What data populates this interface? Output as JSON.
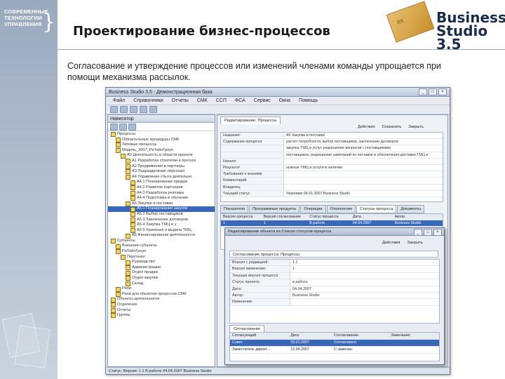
{
  "brand": {
    "company_logo": "СОВРЕМЕННЫЕ ТЕХНОЛОГИИ УПРАВЛЕНИЯ",
    "product_name": "Business Studio 3.5"
  },
  "slide": {
    "title": "Проектирование бизнес-процессов",
    "description": "Согласование и утверждение процессов или изменений членами команды упрощается при помощи механизма рассылок."
  },
  "app": {
    "title": "Business Studio 3.5 - Демонстрационная база",
    "menu": [
      "Файл",
      "Справочники",
      "Отчеты",
      "СМК",
      "ССП",
      "ФСА",
      "Сервис",
      "Окна",
      "Помощь"
    ],
    "navigator": {
      "title": "Навигатор",
      "items": [
        "Процессы",
        "Обязательные процедуры СМК",
        "Типовые процессы",
        "Модель_2007_РиТейлГроуп",
        "А0 Деятельность в области проекти",
        "А1 Разработка стратегии и прогноз",
        "А2 Продвижение в партнеры",
        "А3 Подразделение персонал",
        "А4 Управление сбыта деятельно",
        "А4.1 Планирование продаж",
        "А4.2 Развитие партнеров",
        "А4.3 Разработка рекламы",
        "А4.4 Подготовка и обучение",
        "А5 Закупки и поставки",
        "А5.1 Планирование закупок",
        "А5.2 Выбор поставщиков",
        "А5.3 Заключение договоров",
        "А5.4 Закупка ТМЦ и у",
        "А5.5 Хранение и выдача ТМЦ",
        "А6 Финансирование деятельности",
        "Субъекты",
        "Внешние субъекты",
        "РиТейлГроуп",
        "Персонал",
        "Руководство",
        "Администрация",
        "Отдел продаж",
        "Отдел закупок",
        "Склад",
        "Роли",
        "Роли для объектов процессов СМК",
        "Объекты деятельности",
        "Отделение",
        "Отчеты",
        "Группы"
      ],
      "selected_index": 14
    },
    "pane": {
      "tab_label": "Редактирование: Процессы",
      "actions": [
        "Действия",
        "Сохранить",
        "Закрыть"
      ],
      "fields": [
        [
          "Название:",
          "А5 Закупки и поставки"
        ],
        [
          "Содержание процесса",
          "расчет потребности, выбор поставщиков, заключение договоров"
        ],
        [
          "",
          "закупка ТМЦ и услуг, разрешение вопросов с поставщиками"
        ],
        [
          "",
          "поставщиков, разрешение замечаний по поставке и обеспечения доставки ТМЦ и"
        ],
        [
          "Начало",
          ""
        ],
        [
          "Результат",
          "нужные ТМЦ и услуги в наличии"
        ],
        [
          "Требования к знаниям",
          ""
        ],
        [
          "Комментарий",
          ""
        ],
        [
          "Владелец",
          ""
        ],
        [
          "Текущий статус",
          "Черновик 04.01.2007 Business Studio"
        ]
      ],
      "tabs": [
        "Показатели",
        "Программные продукты",
        "Операции",
        "Отклонения",
        "Статусы процесса",
        "Документы"
      ],
      "active_tab": 4,
      "status_grid": {
        "headers": [
          "Версия процесса",
          "Версия согласования",
          "Статус процесса",
          "Дата",
          "Автор"
        ],
        "rows": [
          [
            "1",
            "1",
            "В работе",
            "04.04.2007",
            "Business Studio"
          ]
        ]
      }
    },
    "status_bar": "Статус: Версия: 1.1 В работе 04.04.2007 Business Studio"
  },
  "popup": {
    "title": "Редактирование объекта из Список статусов процесса",
    "actions": [
      "Действия",
      "Закрыть"
    ],
    "header": "Согласование процесса: Процессы",
    "fields": [
      [
        "Версия с редакцией:",
        "1.1"
      ],
      [
        "Версия изменения:",
        "1"
      ],
      [
        "Текущая версия процесса",
        ""
      ],
      [
        "Статус проекта:",
        "в работе"
      ],
      [
        "Дата:",
        "04.04.2007"
      ],
      [
        "Автор:",
        "Business Studio"
      ],
      [
        "Изменение:",
        ""
      ]
    ],
    "tab": "Согласование",
    "grid": {
      "headers": [
        "Согласующий",
        "Дата",
        "Согласование",
        "Замечания"
      ],
      "rows": [
        [
          "Совет",
          "03.01.2007",
          "Согласовано",
          ""
        ],
        [
          "Заместитель директ...",
          "12.04.2007",
          "С замечан.",
          ""
        ]
      ]
    }
  },
  "colors": {
    "strip": "#9aa9bd",
    "selection": "#3a68b8",
    "brand_text": "#1b2c4a"
  }
}
